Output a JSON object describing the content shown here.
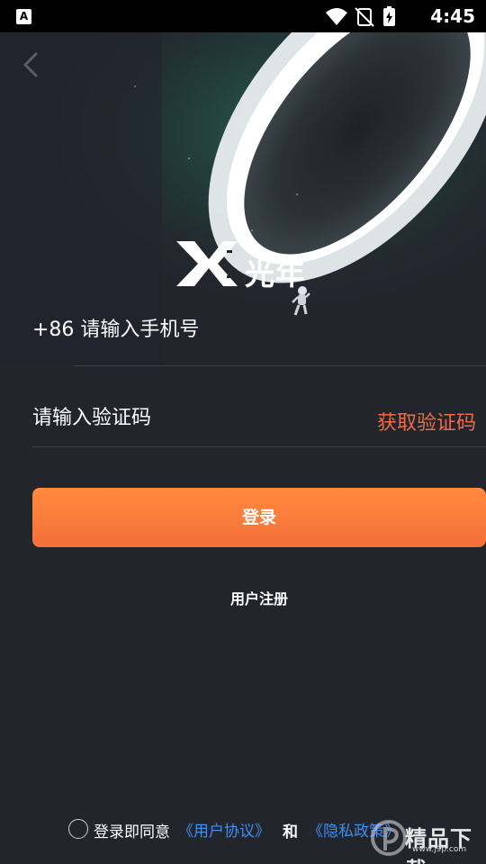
{
  "status_bar": {
    "app_icon_letter": "A",
    "time": "4:45"
  },
  "header": {
    "back_icon": "chevron-left-icon"
  },
  "logo": {
    "brand_name": "光年"
  },
  "form": {
    "phone_label": "+86 请输入手机号",
    "code_label": "请输入验证码",
    "get_code_label": "获取验证码",
    "login_label": "登录",
    "register_label": "用户注册"
  },
  "agreement": {
    "prefix": "登录即同意",
    "user_agreement": "《用户协议》",
    "and": "和",
    "privacy_policy": "《隐私政策》"
  },
  "watermark": {
    "text": "精品下载",
    "sub": "www.j9p.com"
  },
  "colors": {
    "background": "#23252d",
    "accent_orange": "#f4703a",
    "link_blue": "#3f8ef0",
    "get_code_orange": "#f06a43"
  }
}
